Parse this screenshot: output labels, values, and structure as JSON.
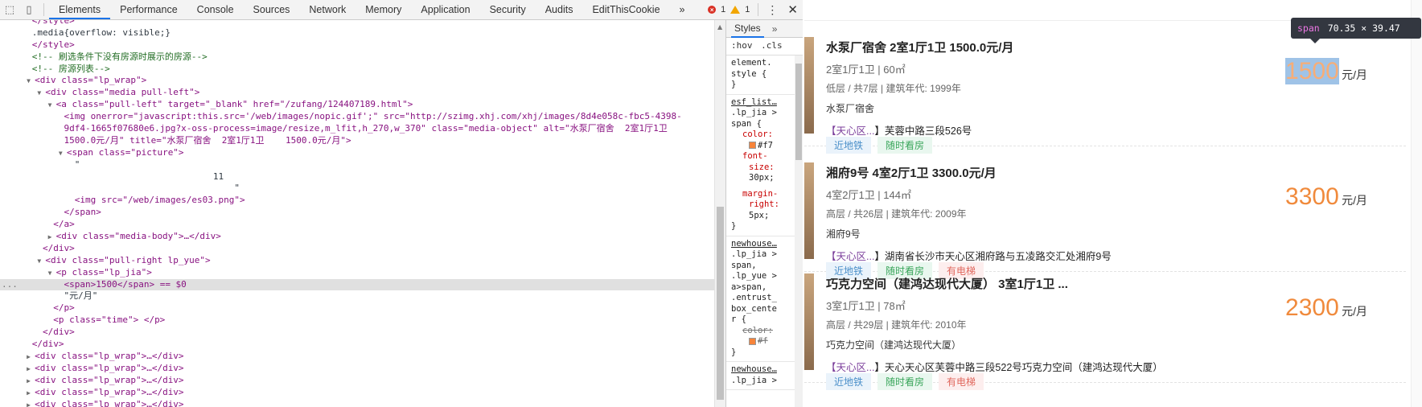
{
  "devtools": {
    "tabs": [
      "Elements",
      "Performance",
      "Console",
      "Sources",
      "Network",
      "Memory",
      "Application",
      "Security",
      "Audits",
      "EditThisCookie"
    ],
    "more_tabs_glyph": "»",
    "error_count": "1",
    "warning_count": "1",
    "elements": {
      "lines": [
        {
          "indent": 3,
          "html": "&lt;/style&gt;",
          "cls": "tag",
          "partial": true,
          "text": "</style>"
        },
        {
          "indent": 3,
          "text": ".media{overflow: visible;}",
          "cls": "txt"
        },
        {
          "indent": 3,
          "text": "</style>",
          "cls": "tag"
        },
        {
          "indent": 3,
          "text": "<!-- 刷选条件下没有房源时展示的房源-->",
          "cls": "cmt"
        },
        {
          "indent": 3,
          "text": "<!-- 房源列表-->",
          "cls": "cmt"
        },
        {
          "indent": 3,
          "tri": "▼",
          "text": "<div class=\"lp_wrap\">"
        },
        {
          "indent": 4,
          "tri": "▼",
          "text": "<div class=\"media pull-left\">"
        },
        {
          "indent": 5,
          "tri": "▼",
          "text": "<a class=\"pull-left\" target=\"_blank\" href=\"/zufang/124407189.html\">"
        },
        {
          "indent": 6,
          "text": "<img onerror=\"javascript:this.src='/web/images/nopic.gif';\" src=\"http://szimg.xhj.com/xhj/images/8d4e058c-fbc5-4398-"
        },
        {
          "indent": 6,
          "text": "9df4-1665f07680e6.jpg?x-oss-process=image/resize,m_lfit,h_270,w_370\" class=\"media-object\" alt=\"水泵厂宿舍  2室1厅1卫"
        },
        {
          "indent": 6,
          "text": "1500.0元/月\" title=\"水泵厂宿舍  2室1厅1卫    1500.0元/月\">"
        },
        {
          "indent": 6,
          "tri": "▼",
          "text": "<span class=\"picture\">"
        },
        {
          "indent": 7,
          "text": "\"",
          "cls": "txt"
        },
        {
          "indent": 20,
          "text": "11",
          "cls": "txt"
        },
        {
          "indent": 22,
          "text": "\"",
          "cls": "txt"
        },
        {
          "indent": 7,
          "text": "<img src=\"/web/images/es03.png\">"
        },
        {
          "indent": 6,
          "text": "</span>"
        },
        {
          "indent": 5,
          "text": "</a>"
        },
        {
          "indent": 5,
          "tri": "▶",
          "text": "<div class=\"media-body\">…</div>"
        },
        {
          "indent": 4,
          "text": "</div>"
        },
        {
          "indent": 4,
          "tri": "▼",
          "text": "<div class=\"pull-right lp_yue\">"
        },
        {
          "indent": 5,
          "tri": "▼",
          "text": "<p class=\"lp_jia\">"
        },
        {
          "indent": 6,
          "text": "<span>1500</span> == $0",
          "sel": true
        },
        {
          "indent": 6,
          "text": "\"元/月\"",
          "cls": "txt"
        },
        {
          "indent": 5,
          "text": "</p>"
        },
        {
          "indent": 5,
          "text": "<p class=\"time\"> </p>"
        },
        {
          "indent": 4,
          "text": "</div>"
        },
        {
          "indent": 3,
          "text": "</div>"
        },
        {
          "indent": 3,
          "tri": "▶",
          "text": "<div class=\"lp_wrap\">…</div>"
        },
        {
          "indent": 3,
          "tri": "▶",
          "text": "<div class=\"lp_wrap\">…</div>"
        },
        {
          "indent": 3,
          "tri": "▶",
          "text": "<div class=\"lp_wrap\">…</div>"
        },
        {
          "indent": 3,
          "tri": "▶",
          "text": "<div class=\"lp_wrap\">…</div>"
        },
        {
          "indent": 3,
          "tri": "▶",
          "text": "<div class=\"lp_wrap\">…</div>"
        }
      ],
      "selected_marker": "..."
    },
    "styles": {
      "tab_label": "Styles",
      "more": "»",
      "filter_hov": ":hov",
      "filter_cls": ".cls",
      "element_style_l1": "element.",
      "element_style_l2": "style {",
      "element_style_l3": "}",
      "rule1_src": "esf_list…",
      "rule1_sel_l1": ".lp_jia >",
      "rule1_sel_l2": "span {",
      "rule1_prop1": "color:",
      "rule1_val1": "#f7",
      "rule1_prop2a": "font-",
      "rule1_prop2b": "size:",
      "rule1_val2": "30px;",
      "rule1_prop3a": "margin-",
      "rule1_prop3b": "right:",
      "rule1_val3": "5px;",
      "rule1_close": "}",
      "rule2_src": "newhouse…",
      "rule2_sel": [
        ".lp_jia >",
        "span,",
        ".lp_yue >",
        "a>span,",
        ".entrust_",
        "box_cente",
        "r {"
      ],
      "rule2_prop": "color:",
      "rule2_val": "#f",
      "rule2_close": "}",
      "rule3_src": "newhouse…",
      "rule3_sel": ".lp_jia >"
    }
  },
  "page": {
    "listings": [
      {
        "title": "水泵厂宿舍 2室1厅1卫 1500.0元/月",
        "spec": "2室1厅1卫 | 60㎡",
        "floor": "低层 / 共7层 | 建筑年代:  1999年",
        "name": "水泵厂宿舍",
        "district": "【天心区...",
        "address": "】芙蓉中路三段526号",
        "tags": [
          {
            "label": "近地铁",
            "kind": "blue"
          },
          {
            "label": "随时看房",
            "kind": "green"
          }
        ],
        "price": "1500",
        "unit": "元/月"
      },
      {
        "title": "湘府9号 4室2厅1卫 3300.0元/月",
        "spec": "4室2厅1卫 | 144㎡",
        "floor": "高层 / 共26层 | 建筑年代:  2009年",
        "name": "湘府9号",
        "district": "【天心区...",
        "address": "】湖南省长沙市天心区湘府路与五凌路交汇处湘府9号",
        "tags": [
          {
            "label": "近地铁",
            "kind": "blue"
          },
          {
            "label": "随时看房",
            "kind": "green"
          },
          {
            "label": "有电梯",
            "kind": "red"
          }
        ],
        "price": "3300",
        "unit": "元/月"
      },
      {
        "title": "巧克力空间（建鸿达现代大厦） 3室1厅1卫 ...",
        "spec": "3室1厅1卫 | 78㎡",
        "floor": "高层 / 共29层 | 建筑年代:  2010年",
        "name": "巧克力空间（建鸿达现代大厦）",
        "district": "【天心区...",
        "address": "】天心天心区芙蓉中路三段522号巧克力空间（建鸿达现代大厦）",
        "tags": [
          {
            "label": "近地铁",
            "kind": "blue"
          },
          {
            "label": "随时看房",
            "kind": "green"
          },
          {
            "label": "有电梯",
            "kind": "red"
          }
        ],
        "price": "2300",
        "unit": "元/月"
      }
    ],
    "tooltip": {
      "tag": "span",
      "size": "70.35 × 39.47"
    }
  }
}
